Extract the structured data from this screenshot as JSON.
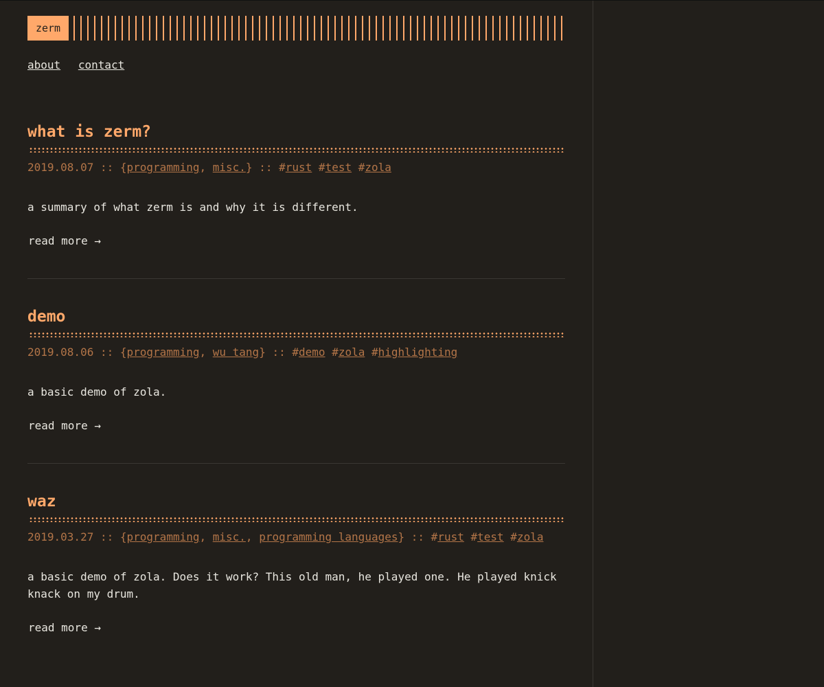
{
  "site": {
    "logo": "zerm",
    "nav": [
      "about",
      "contact"
    ]
  },
  "posts": [
    {
      "title": "what is zerm?",
      "date": "2019.08.07",
      "categories": [
        "programming",
        "misc."
      ],
      "tags": [
        "rust",
        "test",
        "zola"
      ],
      "summary": "a summary of what zerm is and why it is different.",
      "read_more": "read more →"
    },
    {
      "title": "demo",
      "date": "2019.08.06",
      "categories": [
        "programming",
        "wu tang"
      ],
      "tags": [
        "demo",
        "zola",
        "highlighting"
      ],
      "summary": "a basic demo of zola.",
      "read_more": "read more →"
    },
    {
      "title": "waz",
      "date": "2019.03.27",
      "categories": [
        "programming",
        "misc.",
        "programming languages"
      ],
      "tags": [
        "rust",
        "test",
        "zola"
      ],
      "summary": "a basic demo of zola. Does it work? This old man, he played one. He played knick knack on my drum.",
      "read_more": "read more →"
    }
  ],
  "meta_separator": "::",
  "colors": {
    "accent": "#ffa86a",
    "meta": "#b37548",
    "background": "#221f1b",
    "text": "#e8e6df"
  }
}
